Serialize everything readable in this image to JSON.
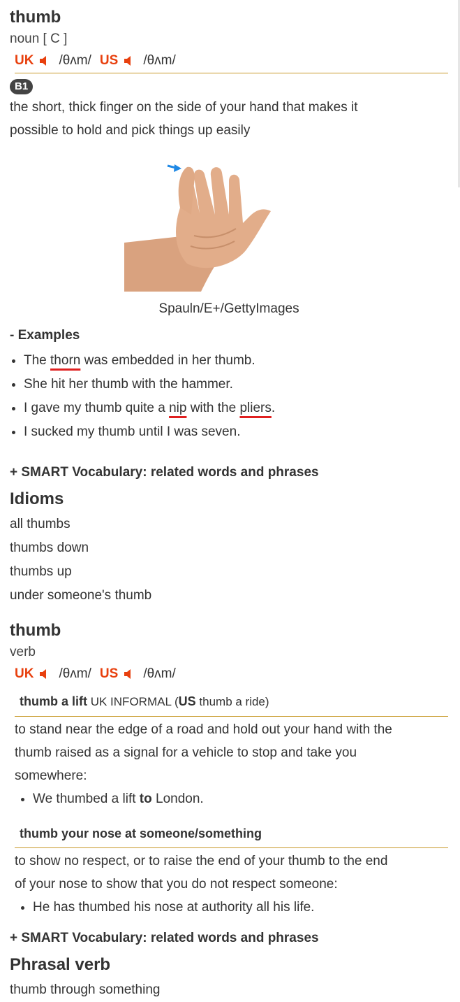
{
  "entry1": {
    "headword": "thumb",
    "pos": "noun [ C ]",
    "uk_label": "UK",
    "uk_ipa": "/θʌm/",
    "us_label": "US",
    "us_ipa": "/θʌm/",
    "level": "B1",
    "definition_1": "the short, thick finger on the side of your hand that makes it",
    "definition_2": "possible to hold and pick things up easily",
    "image_credit": "Spauln/E+/GettyImages",
    "examples_title": "- Examples",
    "examples": [
      {
        "a": "The ",
        "b": "thorn",
        "c": " was embedded in her thumb."
      },
      {
        "a": "She hit her thumb with the hammer."
      },
      {
        "a": "I gave my thumb quite a ",
        "b": "nip",
        "c": " with the ",
        "d": "pliers",
        "e": "."
      },
      {
        "a": "I sucked my thumb until I was seven."
      }
    ],
    "smart_vocab": "+ SMART Vocabulary: related words and phrases",
    "idioms_title": "Idioms",
    "idioms": [
      "all thumbs",
      "thumbs down",
      "thumbs up",
      "under someone's thumb"
    ]
  },
  "entry2": {
    "headword": "thumb",
    "pos": "verb",
    "uk_label": "UK",
    "uk_ipa": "/θʌm/",
    "us_label": "US",
    "us_ipa": "/θʌm/",
    "idiom1": {
      "phrase": "thumb a lift",
      "label": " UK INFORMAL (",
      "us": "US",
      "alt": " thumb a ride)",
      "def_1": "to stand near the edge of a road and hold out your hand with the",
      "def_2": "thumb raised as a signal for a vehicle to stop and take you",
      "def_3": "somewhere:",
      "example_a": "We thumbed a lift ",
      "example_b": "to",
      "example_c": " London."
    },
    "idiom2": {
      "phrase": "thumb your nose at someone/something",
      "def_1": "to show no respect, or to raise the end of your thumb to the end",
      "def_2": "of your nose to show that you do not respect someone:",
      "example": "He has thumbed his nose at authority all his life."
    },
    "smart_vocab": "+ SMART Vocabulary: related words and phrases",
    "phrasal_title": "Phrasal verb",
    "phrasal": [
      "thumb through something"
    ]
  },
  "colors": {
    "accent": "#e8400e",
    "rule": "#c89a2b",
    "underline": "#e02020",
    "badge": "#444444"
  }
}
